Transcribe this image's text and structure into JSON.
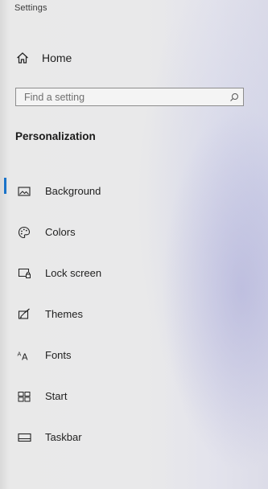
{
  "app": {
    "title": "Settings"
  },
  "home": {
    "label": "Home",
    "icon": "home-icon"
  },
  "search": {
    "placeholder": "Find a setting",
    "value": "",
    "icon": "search-icon"
  },
  "section": {
    "title": "Personalization"
  },
  "nav": {
    "items": [
      {
        "label": "Background",
        "icon": "background-icon",
        "active": true
      },
      {
        "label": "Colors",
        "icon": "colors-icon",
        "active": false
      },
      {
        "label": "Lock screen",
        "icon": "lock-screen-icon",
        "active": false
      },
      {
        "label": "Themes",
        "icon": "themes-icon",
        "active": false
      },
      {
        "label": "Fonts",
        "icon": "fonts-icon",
        "active": false
      },
      {
        "label": "Start",
        "icon": "start-icon",
        "active": false
      },
      {
        "label": "Taskbar",
        "icon": "taskbar-icon",
        "active": false
      }
    ]
  },
  "colors": {
    "accent": "#1a73c9",
    "text": "#1f1f1f",
    "background": "#e9e9e9"
  }
}
